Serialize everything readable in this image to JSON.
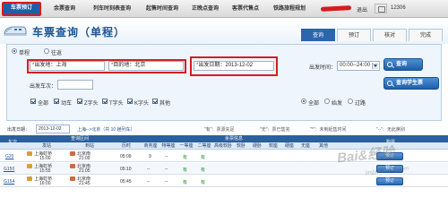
{
  "nav": {
    "tabs": [
      "车票预订",
      "余票查询",
      "列车时刻表查询",
      "起售时间查询",
      "正晚点查询",
      "客票代售点",
      "铁路旅程规划"
    ],
    "logout": "退出",
    "user_number": "12306"
  },
  "header": {
    "title": "车票查询（单程）",
    "tabs": [
      "查询",
      "预订",
      "核对",
      "完成"
    ]
  },
  "query": {
    "trip_types": [
      "单程",
      "往返"
    ],
    "from_label": "出发地：",
    "from_value": "上海",
    "to_label": "目的地：",
    "to_value": "北京",
    "date_label": "出发日期：",
    "date_value": "2013-12-02",
    "time_label": "出发时间：",
    "time_value": "00:00--24:00",
    "search_button": "查询",
    "student_button": "查询学生票",
    "train_no_label": "出发车次：",
    "train_types": [
      "全部",
      "动车",
      "Z字头",
      "T字头",
      "K字头",
      "其他"
    ],
    "filter_options": [
      "全部",
      "始发",
      "过路"
    ]
  },
  "results": {
    "date_label": "出发日期：",
    "date": "2013-12-02",
    "route": "上海-->北京（共 10 趟列车）",
    "legends": [
      "\"有\"：票源充足",
      "\"无\"：票已售完",
      "\"*\"：未到起售时间",
      "\"--\"：无此席别"
    ]
  },
  "table": {
    "header1": [
      "车次",
      "查询区间",
      "余票信息",
      "购票"
    ],
    "header2": [
      "发站",
      "到站",
      "历时",
      "商务座",
      "特等座",
      "一等座",
      "二等座",
      "高级软卧",
      "软卧",
      "硬卧",
      "软座",
      "硬座",
      "无座",
      "其他"
    ],
    "rows": [
      {
        "train": "G20",
        "from": "上海虹桥",
        "from_time": "15:00",
        "to": "北京南",
        "to_time": "21:09",
        "duration": "05:09",
        "biz": "9",
        "special": "--",
        "first": "有",
        "second": "有",
        "book": "预订"
      },
      {
        "train": "G150",
        "from": "上海虹桥",
        "from_time": "15:55",
        "to": "北京南",
        "to_time": "21:05",
        "duration": "05:10",
        "biz": "--",
        "special": "--",
        "first": "有",
        "second": "有",
        "book": "预订"
      },
      {
        "train": "G154",
        "from": "上海虹桥",
        "from_time": "16:00",
        "to": "北京南",
        "to_time": "21:45",
        "duration": "05:45",
        "biz": "--",
        "special": "--",
        "first": "有",
        "second": "有",
        "book": "预订"
      }
    ]
  },
  "watermark": {
    "text": "Bai&经验",
    "url": "jingyan.baidu.com"
  },
  "colors": {
    "primary": "#1f5fa8",
    "highlight_red": "#d51f1f",
    "available_green": "#1d8a2c"
  }
}
